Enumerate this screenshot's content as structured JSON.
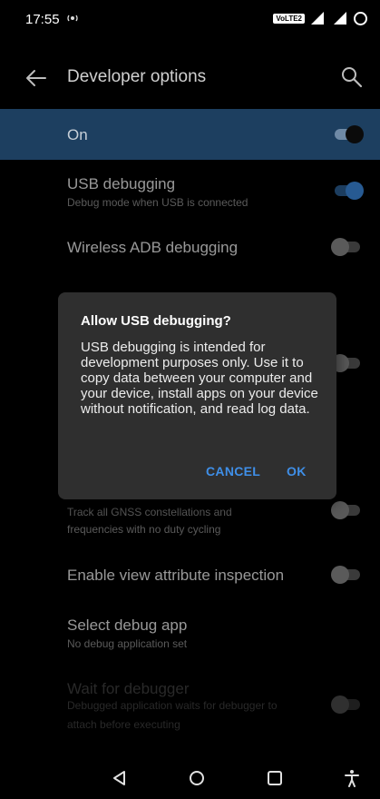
{
  "status_bar": {
    "time": "17:55",
    "notification_icon": "signal-boost-icon",
    "volte_label": "VoLTE2",
    "signal_icon": "cellular-signal-icon",
    "battery_icon": "battery-ring-icon"
  },
  "toolbar": {
    "title": "Developer options",
    "back_icon": "arrow-left-icon",
    "search_icon": "search-icon"
  },
  "master_switch": {
    "label": "On",
    "state": "on"
  },
  "settings": [
    {
      "title": "USB debugging",
      "subtitle": "Debug mode when USB is connected",
      "state": "on"
    },
    {
      "title": "Wireless ADB debugging",
      "subtitle": "",
      "state": "off"
    },
    {
      "title": "",
      "subtitle": "Track all GNSS constellations and frequencies with no duty cycling",
      "subtitle_line1": "Track all GNSS constellations and",
      "subtitle_line2": "frequencies with no duty cycling",
      "state": "off"
    },
    {
      "title": "Enable view attribute inspection",
      "subtitle": "",
      "state": "off"
    },
    {
      "title": "Select debug app",
      "subtitle": "No debug application set",
      "state": "none"
    },
    {
      "title": "Wait for debugger",
      "subtitle": "Debugged application waits for debugger to attach before executing",
      "subtitle_line1": "Debugged application waits for debugger to",
      "subtitle_line2": "attach before executing",
      "state": "off",
      "enabled": false
    }
  ],
  "dialog": {
    "title": "Allow USB debugging?",
    "body": "USB debugging is intended for development purposes only. Use it to copy data between your computer and your device, install apps on your device without notification, and read log data.",
    "cancel_label": "CANCEL",
    "ok_label": "OK"
  },
  "nav_bar": {
    "back_icon": "triangle-back-icon",
    "home_icon": "circle-home-icon",
    "recents_icon": "square-recents-icon",
    "accessibility_icon": "accessibility-icon"
  },
  "colors": {
    "accent": "#3f8fe8",
    "master_bg": "#1d3f60",
    "dialog_bg": "#2f2f2f"
  }
}
